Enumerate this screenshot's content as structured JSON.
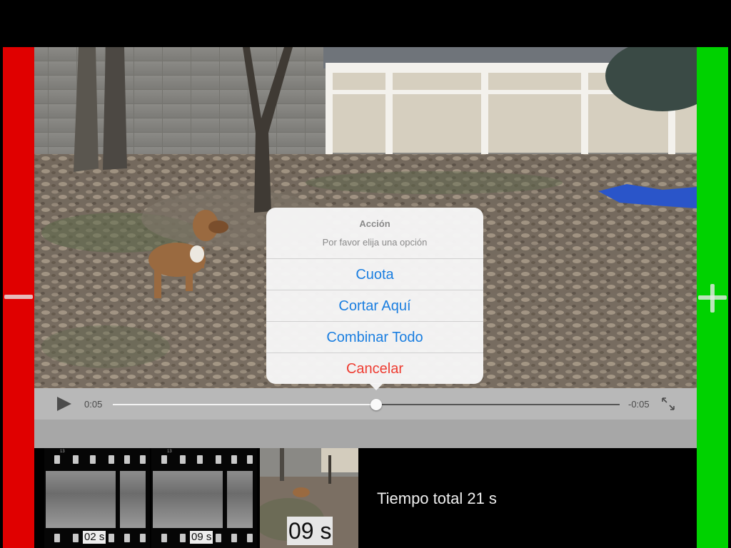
{
  "player": {
    "time_elapsed": "0:05",
    "time_remaining": "-0:05",
    "progress": 0.52,
    "play_icon": "play-icon",
    "fullscreen_icon": "expand-icon"
  },
  "sidebar": {
    "left_icon": "minus-icon",
    "left_color": "#e00000",
    "right_icon": "plus-icon",
    "right_color": "#00d200"
  },
  "action_sheet": {
    "title": "Acción",
    "message": "Por favor elija una opción",
    "actions": [
      {
        "label": "Cuota",
        "style": "default"
      },
      {
        "label": "Cortar Aquí",
        "style": "default"
      },
      {
        "label": "Combinar Todo",
        "style": "default"
      },
      {
        "label": "Cancelar",
        "style": "destructive"
      }
    ],
    "accent_color": "#1a7ee0",
    "destructive_color": "#ee3b30"
  },
  "timeline": {
    "clips": [
      {
        "duration": "02 s",
        "frame_number": "13"
      },
      {
        "duration": "09 s",
        "frame_number": "13"
      }
    ],
    "current_clip_duration": "09 s",
    "total_time": "Tiempo total 21 s"
  }
}
